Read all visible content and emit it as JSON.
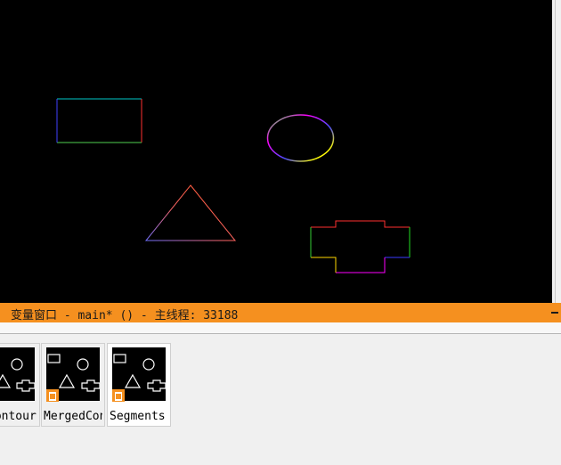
{
  "window": {
    "title": "变量窗口 - main* () - 主线程: 33188"
  },
  "canvas": {
    "background": "#000000",
    "shapes": [
      "rectangle",
      "ellipse",
      "triangle",
      "cross"
    ]
  },
  "thumbnails": [
    {
      "label": "Contour",
      "selected": false
    },
    {
      "label": "MergedContours",
      "selected": false
    },
    {
      "label": "Segments",
      "selected": true
    }
  ],
  "colors": {
    "accent": "#f5901f",
    "panel": "#f0f0f0"
  },
  "icons": {
    "minimize": "minimize-icon",
    "badge": "vector-variable-icon"
  }
}
